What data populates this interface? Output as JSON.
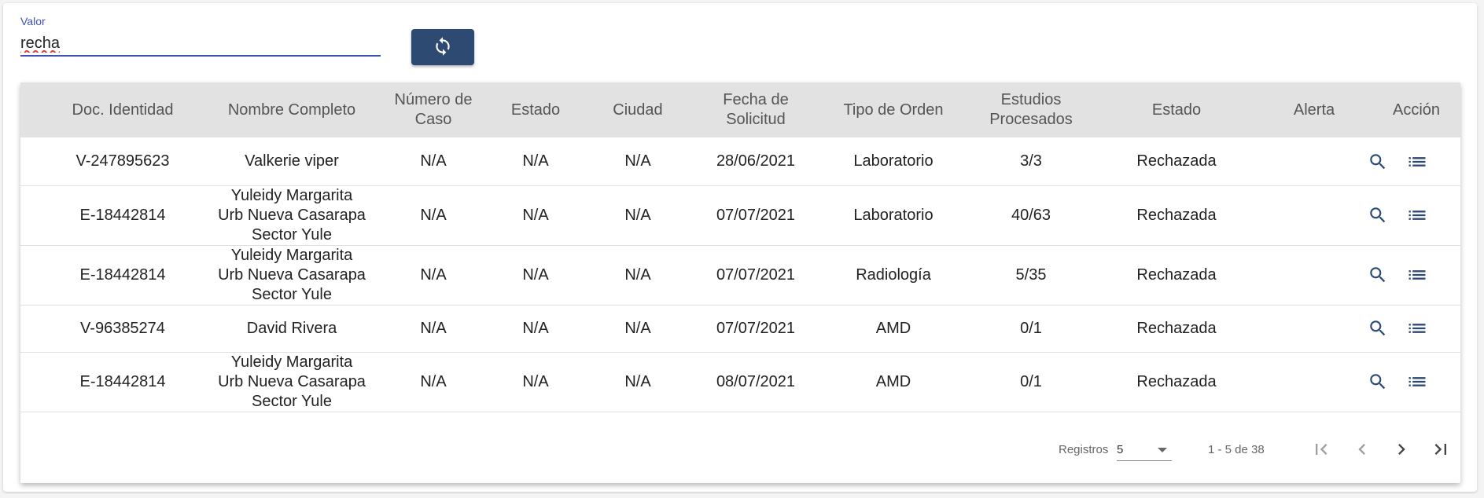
{
  "filter": {
    "label": "Valor",
    "value": "recha"
  },
  "refresh_icon": "refresh-icon",
  "table": {
    "headers": {
      "doc": "Doc. Identidad",
      "nombre": "Nombre Completo",
      "caso": "Número de Caso",
      "estado1": "Estado",
      "ciudad": "Ciudad",
      "fecha": "Fecha de Solicitud",
      "tipo": "Tipo de Orden",
      "estudios": "Estudios Procesados",
      "estado2": "Estado",
      "alerta": "Alerta",
      "accion": "Acción"
    },
    "rows": [
      {
        "doc": "V-247895623",
        "nombre": "Valkerie viper",
        "caso": "N/A",
        "estado1": "N/A",
        "ciudad": "N/A",
        "fecha": "28/06/2021",
        "tipo": "Laboratorio",
        "estudios": "3/3",
        "estado2": "Rechazada",
        "alerta": ""
      },
      {
        "doc": "E-18442814",
        "nombre": "Yuleidy Margarita Urb Nueva Casarapa Sector Yule",
        "caso": "N/A",
        "estado1": "N/A",
        "ciudad": "N/A",
        "fecha": "07/07/2021",
        "tipo": "Laboratorio",
        "estudios": "40/63",
        "estado2": "Rechazada",
        "alerta": ""
      },
      {
        "doc": "E-18442814",
        "nombre": "Yuleidy Margarita Urb Nueva Casarapa Sector Yule",
        "caso": "N/A",
        "estado1": "N/A",
        "ciudad": "N/A",
        "fecha": "07/07/2021",
        "tipo": "Radiología",
        "estudios": "5/35",
        "estado2": "Rechazada",
        "alerta": ""
      },
      {
        "doc": "V-96385274",
        "nombre": "David Rivera",
        "caso": "N/A",
        "estado1": "N/A",
        "ciudad": "N/A",
        "fecha": "07/07/2021",
        "tipo": "AMD",
        "estudios": "0/1",
        "estado2": "Rechazada",
        "alerta": ""
      },
      {
        "doc": "E-18442814",
        "nombre": "Yuleidy Margarita Urb Nueva Casarapa Sector Yule",
        "caso": "N/A",
        "estado1": "N/A",
        "ciudad": "N/A",
        "fecha": "08/07/2021",
        "tipo": "AMD",
        "estudios": "0/1",
        "estado2": "Rechazada",
        "alerta": ""
      }
    ],
    "action_icons": [
      "search-icon",
      "list-icon"
    ]
  },
  "paginator": {
    "registros_label": "Registros",
    "page_size": "5",
    "range_label": "1 - 5 de 38"
  },
  "colors": {
    "primary": "#2d4a73",
    "accent": "#3f51b5",
    "header_bg": "#e2e2e2"
  }
}
